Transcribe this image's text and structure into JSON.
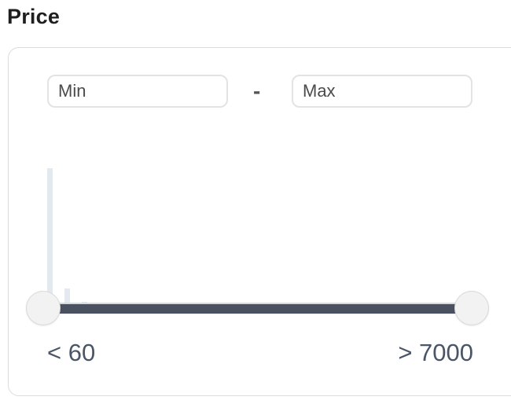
{
  "filter": {
    "title": "Price",
    "min_placeholder": "Min",
    "max_placeholder": "Max",
    "separator": "-",
    "scale_min_label": "< 60",
    "scale_max_label": "> 7000",
    "range_low_fraction": 0.0,
    "range_high_fraction": 1.0,
    "track_color": "#4a5160",
    "histogram_color": "#e4e8ef"
  },
  "histogram": {
    "relative_counts": [
      1.0,
      0.11,
      0.01
    ]
  }
}
